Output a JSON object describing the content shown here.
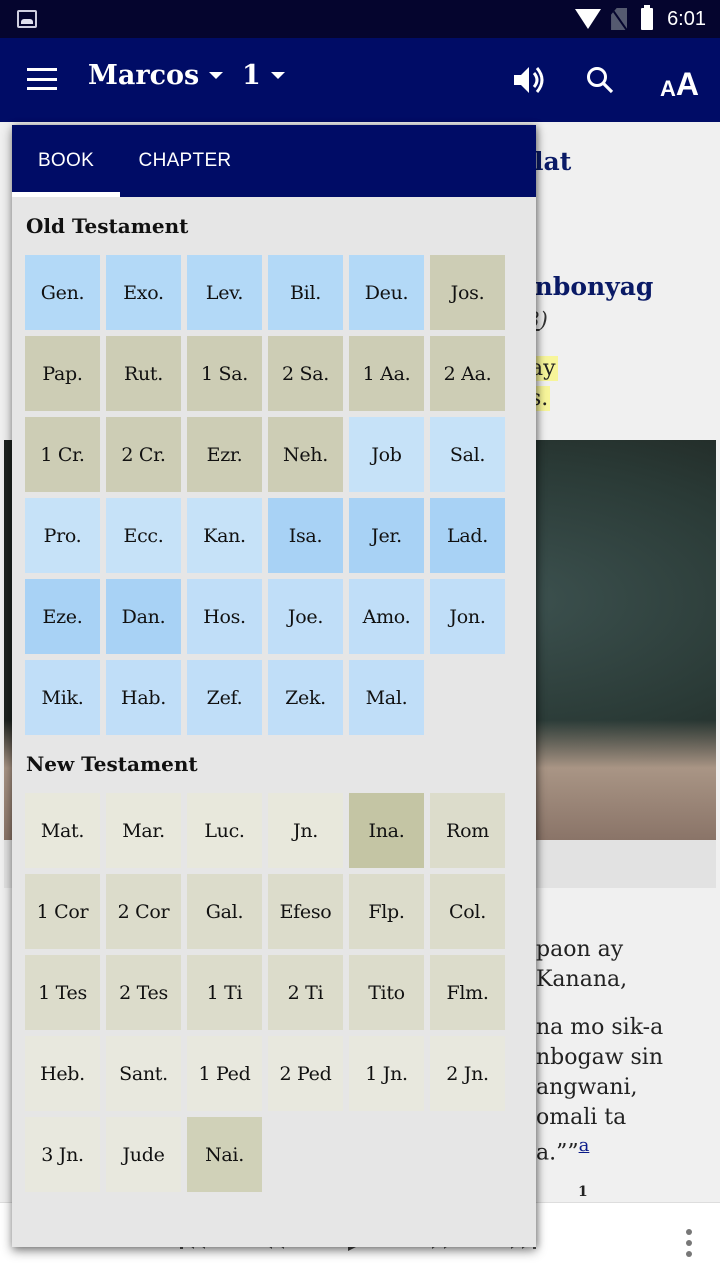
{
  "status_bar": {
    "time": "6:01",
    "icons": [
      "gallery-notification-icon",
      "wifi-icon",
      "no-sim-icon",
      "battery-icon"
    ]
  },
  "app_bar": {
    "book": "Marcos",
    "chapter": "1",
    "icons": [
      "menu-icon",
      "speaker-icon",
      "search-icon",
      "font-size-icon"
    ],
    "font_size_small": "A",
    "font_size_big": "A"
  },
  "reader": {
    "heading_1_fragment": "lat",
    "heading_2_fragment": "onbonyag",
    "reference_prefix": "(",
    "reference_link": "8",
    "reference_suffix": ")",
    "highlight_lines": [
      "ay",
      "s."
    ],
    "verse_lines": [
      "paon ay",
      "Kanana,",
      "na mo sik-a",
      "nbogaw sin",
      "angwani,",
      "omali ta",
      "a.””"
    ],
    "footnote": "a",
    "next_verse_number": "1"
  },
  "picker": {
    "tabs": [
      {
        "label": "BOOK",
        "active": true
      },
      {
        "label": "CHAPTER",
        "active": false
      }
    ],
    "old_testament": {
      "title": "Old Testament",
      "books": [
        {
          "label": "Gen.",
          "color": "#b3d9f7"
        },
        {
          "label": "Exo.",
          "color": "#b3d9f7"
        },
        {
          "label": "Lev.",
          "color": "#b3d9f7"
        },
        {
          "label": "Bil.",
          "color": "#b3d9f7"
        },
        {
          "label": "Deu.",
          "color": "#b3d9f7"
        },
        {
          "label": "Jos.",
          "color": "#cdcdb5"
        },
        {
          "label": "Pap.",
          "color": "#cdcdb5"
        },
        {
          "label": "Rut.",
          "color": "#cdcdb5"
        },
        {
          "label": "1 Sa.",
          "color": "#cdcdb5"
        },
        {
          "label": "2 Sa.",
          "color": "#cdcdb5"
        },
        {
          "label": "1 Aa.",
          "color": "#cdcdb5"
        },
        {
          "label": "2 Aa.",
          "color": "#cdcdb5"
        },
        {
          "label": "1 Cr.",
          "color": "#cdcdb5"
        },
        {
          "label": "2 Cr.",
          "color": "#cdcdb5"
        },
        {
          "label": "Ezr.",
          "color": "#cdcdb5"
        },
        {
          "label": "Neh.",
          "color": "#cdcdb5"
        },
        {
          "label": "Job",
          "color": "#c6e2f8"
        },
        {
          "label": "Sal.",
          "color": "#c6e2f8"
        },
        {
          "label": "Pro.",
          "color": "#c6e2f8"
        },
        {
          "label": "Ecc.",
          "color": "#c6e2f8"
        },
        {
          "label": "Kan.",
          "color": "#c6e2f8"
        },
        {
          "label": "Isa.",
          "color": "#a8d2f5"
        },
        {
          "label": "Jer.",
          "color": "#a8d2f5"
        },
        {
          "label": "Lad.",
          "color": "#a8d2f5"
        },
        {
          "label": "Eze.",
          "color": "#a8d2f5"
        },
        {
          "label": "Dan.",
          "color": "#a8d2f5"
        },
        {
          "label": "Hos.",
          "color": "#c0def8"
        },
        {
          "label": "Joe.",
          "color": "#c0def8"
        },
        {
          "label": "Amo.",
          "color": "#c0def8"
        },
        {
          "label": "Jon.",
          "color": "#c0def8"
        },
        {
          "label": "Mik.",
          "color": "#c0def8"
        },
        {
          "label": "Hab.",
          "color": "#c0def8"
        },
        {
          "label": "Zef.",
          "color": "#c0def8"
        },
        {
          "label": "Zek.",
          "color": "#c0def8"
        },
        {
          "label": "Mal.",
          "color": "#c0def8"
        }
      ]
    },
    "new_testament": {
      "title": "New Testament",
      "books": [
        {
          "label": "Mat.",
          "color": "#e8e8dc"
        },
        {
          "label": "Mar.",
          "color": "#e8e8dc"
        },
        {
          "label": "Luc.",
          "color": "#e8e8dc"
        },
        {
          "label": "Jn.",
          "color": "#e8e8dc"
        },
        {
          "label": "Ina.",
          "color": "#c4c5a4"
        },
        {
          "label": "Rom",
          "color": "#dcdccb"
        },
        {
          "label": "1 Cor",
          "color": "#dcdccb"
        },
        {
          "label": "2 Cor",
          "color": "#dcdccb"
        },
        {
          "label": "Gal.",
          "color": "#dcdccb"
        },
        {
          "label": "Efeso",
          "color": "#dcdccb"
        },
        {
          "label": "Flp.",
          "color": "#dcdccb"
        },
        {
          "label": "Col.",
          "color": "#dcdccb"
        },
        {
          "label": "1 Tes",
          "color": "#dcdccb"
        },
        {
          "label": "2 Tes",
          "color": "#dcdccb"
        },
        {
          "label": "1 Ti",
          "color": "#dcdccb"
        },
        {
          "label": "2 Ti",
          "color": "#dcdccb"
        },
        {
          "label": "Tito",
          "color": "#dcdccb"
        },
        {
          "label": "Flm.",
          "color": "#dcdccb"
        },
        {
          "label": "Heb.",
          "color": "#e8e8de"
        },
        {
          "label": "Sant.",
          "color": "#e8e8de"
        },
        {
          "label": "1 Ped",
          "color": "#e8e8de"
        },
        {
          "label": "2 Ped",
          "color": "#e8e8de"
        },
        {
          "label": "1 Jn.",
          "color": "#e8e8de"
        },
        {
          "label": "2 Jn.",
          "color": "#e8e8de"
        },
        {
          "label": "3 Jn.",
          "color": "#e8e8de"
        },
        {
          "label": "Jude",
          "color": "#e8e8de"
        },
        {
          "label": "Nai.",
          "color": "#d0d1b8"
        }
      ]
    }
  },
  "audio_bar": {
    "controls": [
      "skip-to-start-icon",
      "rewind-icon",
      "play-icon",
      "fast-forward-icon",
      "skip-to-end-icon",
      "more-options-icon"
    ]
  },
  "colors": {
    "status_bar": "#05052e",
    "app_bar": "#000c66",
    "heading_text": "#0a1a66",
    "highlight": "#f7f59a",
    "picker_background": "#e6e6e6"
  }
}
